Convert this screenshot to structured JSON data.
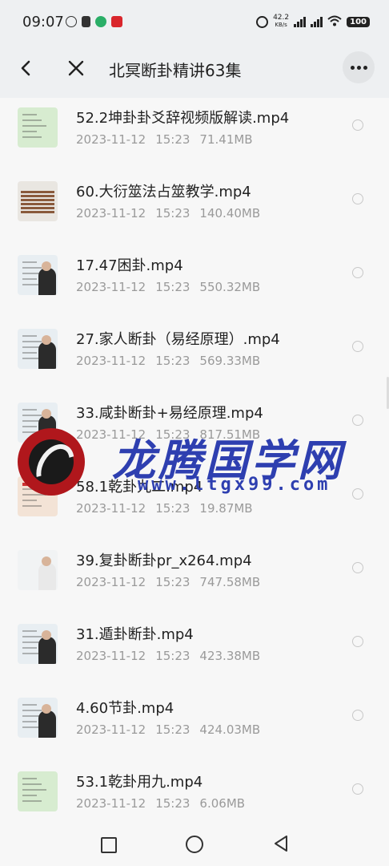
{
  "status_bar": {
    "time": "09:07",
    "speed_value": "42.2",
    "speed_unit": "KB/s",
    "battery": "100"
  },
  "header": {
    "title": "北冥断卦精讲63集"
  },
  "files": [
    {
      "name": "52.2坤卦卦爻辞视频版解读.mp4",
      "date": "2023-11-12",
      "time": "15:23",
      "size": "71.41MB",
      "thumb": "green-doc"
    },
    {
      "name": "60.大衍筮法占筮教学.mp4",
      "date": "2023-11-12",
      "time": "15:23",
      "size": "140.40MB",
      "thumb": "sticks"
    },
    {
      "name": "17.47困卦.mp4",
      "date": "2023-11-12",
      "time": "15:23",
      "size": "550.32MB",
      "thumb": "lecture"
    },
    {
      "name": "27.家人断卦（易经原理）.mp4",
      "date": "2023-11-12",
      "time": "15:23",
      "size": "569.33MB",
      "thumb": "lecture"
    },
    {
      "name": "33.咸卦断卦+易经原理.mp4",
      "date": "2023-11-12",
      "time": "15:23",
      "size": "817.51MB",
      "thumb": "lecture"
    },
    {
      "name": "58.1乾卦九二.mp4",
      "date": "2023-11-12",
      "time": "15:23",
      "size": "19.87MB",
      "thumb": "red-doc"
    },
    {
      "name": "39.复卦断卦pr_x264.mp4",
      "date": "2023-11-12",
      "time": "15:23",
      "size": "747.58MB",
      "thumb": "lecture-light"
    },
    {
      "name": "31.遁卦断卦.mp4",
      "date": "2023-11-12",
      "time": "15:23",
      "size": "423.38MB",
      "thumb": "lecture"
    },
    {
      "name": "4.60节卦.mp4",
      "date": "2023-11-12",
      "time": "15:23",
      "size": "424.03MB",
      "thumb": "lecture"
    },
    {
      "name": "53.1乾卦用九.mp4",
      "date": "2023-11-12",
      "time": "15:23",
      "size": "6.06MB",
      "thumb": "green-doc"
    }
  ],
  "watermark": {
    "text": "龙腾国学网",
    "url": "www.ltgx99.com"
  },
  "colors": {
    "background": "#f7f7f7",
    "header_bg": "#eef0f2",
    "watermark_blue": "#2e3fb0",
    "watermark_red": "#b0171c"
  }
}
